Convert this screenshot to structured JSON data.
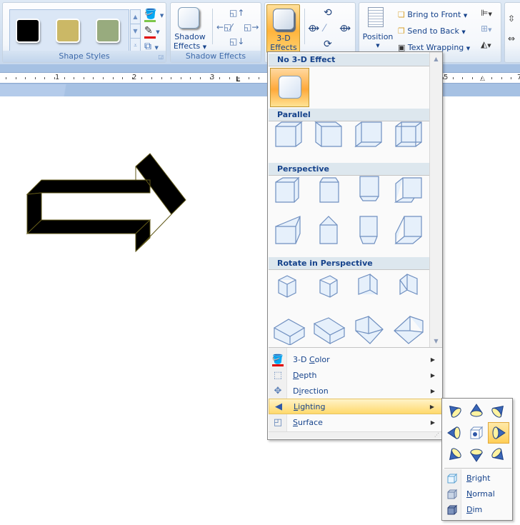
{
  "ribbon": {
    "shape_styles": {
      "label": "Shape Styles",
      "swatches": [
        {
          "name": "black-style",
          "color": "#000000"
        },
        {
          "name": "tan-style",
          "color": "#cbb866"
        },
        {
          "name": "sage-style",
          "color": "#98ab7e"
        }
      ],
      "fill_color": "#7cc64a",
      "outline_color": "#e00000"
    },
    "shadow_effects": {
      "label": "Shadow Effects",
      "button_line1": "Shadow",
      "button_line2": "Effects"
    },
    "three_d": {
      "button_line1": "3-D",
      "button_line2": "Effects"
    },
    "arrange": {
      "position_label": "Position",
      "bring_to_front": "Bring to Front",
      "send_to_back": "Send to Back",
      "text_wrapping": "Text Wrapping"
    }
  },
  "ruler": {
    "numbers": [
      "1",
      "2",
      "3",
      "5",
      "7"
    ]
  },
  "menu": {
    "sections": {
      "none": "No 3-D Effect",
      "parallel": "Parallel",
      "perspective": "Perspective",
      "rotate": "Rotate in Perspective"
    },
    "items": [
      {
        "pre": "3-D ",
        "key": "C",
        "post": "olor"
      },
      {
        "pre": "",
        "key": "D",
        "post": "epth"
      },
      {
        "pre": "D",
        "key": "i",
        "post": "rection"
      },
      {
        "pre": "",
        "key": "L",
        "post": "ighting"
      },
      {
        "pre": "",
        "key": "S",
        "post": "urface"
      }
    ],
    "highlighted_item": "Lighting"
  },
  "lighting_submenu": {
    "directions": [
      "top-left",
      "top",
      "top-right",
      "left",
      "front",
      "right",
      "bottom-left",
      "bottom",
      "bottom-right"
    ],
    "selected": "right",
    "intensity": [
      {
        "key": "B",
        "post": "right"
      },
      {
        "key": "N",
        "post": "ormal"
      },
      {
        "key": "D",
        "post": "im"
      }
    ]
  }
}
